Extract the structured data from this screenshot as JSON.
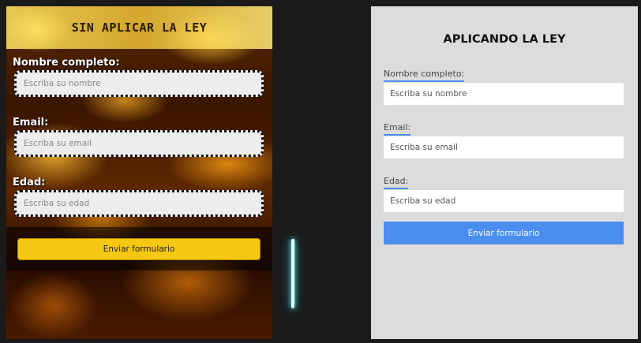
{
  "left": {
    "title": "SIN APLICAR LA LEY",
    "fields": [
      {
        "label": "Nombre completo:",
        "placeholder": "Escriba su nombre"
      },
      {
        "label": "Email:",
        "placeholder": "Escriba su email"
      },
      {
        "label": "Edad:",
        "placeholder": "Escriba su edad"
      }
    ],
    "submit_label": "Enviar formulario",
    "colors": {
      "button": "#f6c713",
      "label": "#ffffff"
    }
  },
  "right": {
    "title": "APLICANDO LA LEY",
    "fields": [
      {
        "label": "Nombre completo:",
        "placeholder": "Escriba su nombre"
      },
      {
        "label": "Email:",
        "placeholder": "Escriba su email"
      },
      {
        "label": "Edad:",
        "placeholder": "Escriba su edad"
      }
    ],
    "submit_label": "Enviar formulario",
    "colors": {
      "accent": "#4a8ef0",
      "background": "#dcdcdc"
    }
  }
}
